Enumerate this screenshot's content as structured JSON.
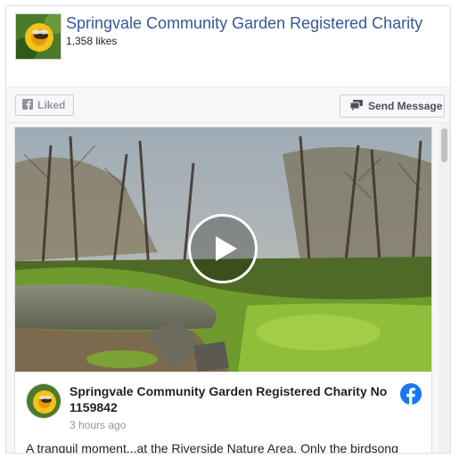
{
  "page": {
    "name": "Springvale Community Garden Registered Charity",
    "likes": "1,358 likes"
  },
  "actions": {
    "liked_label": "Liked",
    "send_message_label": "Send Message"
  },
  "post": {
    "author": "Springvale Community Garden Registered Charity No 1159842",
    "time": "3 hours ago",
    "text": "A tranquil moment...at the Riverside Nature Area. Only the birdsong"
  },
  "icons": {
    "fb_logo": "facebook-logo-icon",
    "play": "play-icon",
    "liked": "facebook-f-icon",
    "message": "message-icon"
  },
  "colors": {
    "link_blue": "#365899",
    "fb_blue": "#1877f2"
  }
}
